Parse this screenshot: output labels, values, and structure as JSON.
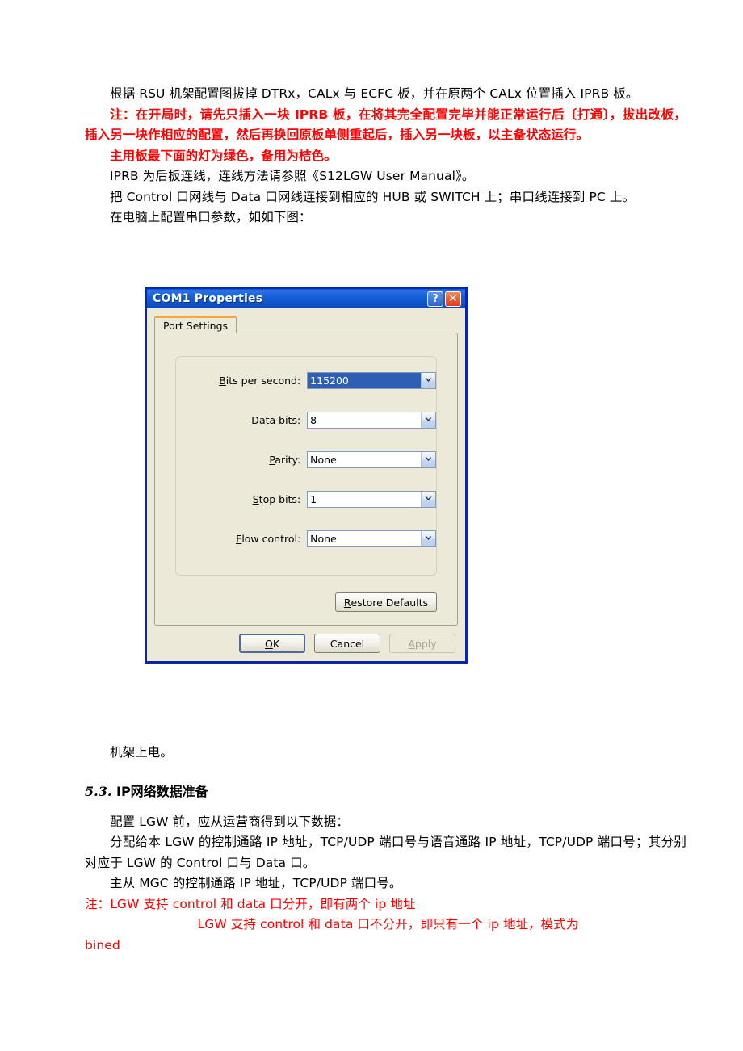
{
  "document": {
    "paragraphs": [
      {
        "id": "p1",
        "text": "根据 RSU 机架配置图拔掉 DTRx，CALx 与 ECFC 板，并在原两个 CALx 位置插入 IPRB 板。",
        "color": "#000000"
      },
      {
        "id": "p2",
        "text": "注：在开局时，请先只插入一块 IPRB 板，在将其完全配置完毕并能正常运行后〔打通〕，拔出改板，插入另一块作相应的配置，然后再换回原板单侧重起后，插入另一块板，以主备状态运行。",
        "color": "#ff0000"
      },
      {
        "id": "p3",
        "text": "主用板最下面的灯为绿色，备用为桔色。",
        "color": "#ff0000"
      },
      {
        "id": "p4",
        "text": "IPRB 为后板连线，连线方法请参照《S12LGW User Manual》。",
        "color": "#000000"
      },
      {
        "id": "p5",
        "text": "把 Control 口网线与 Data 口网线连接到相应的 HUB 或 SWITCH 上；串口线连接到 PC 上。",
        "color": "#000000"
      },
      {
        "id": "p6",
        "text": "在电脑上配置串口参数，如如下图：",
        "color": "#000000"
      }
    ],
    "after_dialog": {
      "rack_power_text": "机架上电。",
      "heading_number": "5.3.",
      "heading_title": "IP网络数据准备",
      "paragraphs": [
        {
          "id": "p7",
          "text": "配置 LGW 前，应从运营商得到以下数据：",
          "color": "#000000"
        },
        {
          "id": "p8",
          "text": "分配给本 LGW 的控制通路 IP 地址，TCP/UDP 端口号与语音通路 IP 地址，TCP/UDP 端口号；其分别对应于 LGW 的 Control 口与 Data 口。",
          "color": "#000000"
        },
        {
          "id": "p9",
          "text": "主从 MGC 的控制通路 IP 地址，TCP/UDP 端口号。",
          "color": "#000000"
        }
      ],
      "note_lines": [
        {
          "id": "n1",
          "text": "注：LGW 支持 control 和 data 口分开，即有两个 ip 地址",
          "indent": false
        },
        {
          "id": "n2",
          "text": "LGW 支持 control 和 data 口不分开，即只有一个 ip 地址，模式为",
          "indent": true
        },
        {
          "id": "n3",
          "text": "bined",
          "indent": false
        }
      ],
      "note_color": "#ff0000"
    }
  },
  "dialog": {
    "title": "COM1 Properties",
    "titlebar_buttons": [
      {
        "name": "help-button",
        "glyph": "?"
      },
      {
        "name": "close-button",
        "glyph": "✕"
      }
    ],
    "tabs": [
      {
        "label": "Port Settings",
        "active": true
      }
    ],
    "fields": [
      {
        "label_prefix": "",
        "label_accel": "B",
        "label_rest": "its per second:",
        "value": "115200",
        "selected": true,
        "name": "bits-per-second"
      },
      {
        "label_prefix": "",
        "label_accel": "D",
        "label_rest": "ata bits:",
        "value": "8",
        "selected": false,
        "name": "data-bits"
      },
      {
        "label_prefix": "",
        "label_accel": "P",
        "label_rest": "arity:",
        "value": "None",
        "selected": false,
        "name": "parity"
      },
      {
        "label_prefix": "",
        "label_accel": "S",
        "label_rest": "top bits:",
        "value": "1",
        "selected": false,
        "name": "stop-bits"
      },
      {
        "label_prefix": "",
        "label_accel": "F",
        "label_rest": "low control:",
        "value": "None",
        "selected": false,
        "name": "flow-control"
      }
    ],
    "restore_defaults": {
      "accel": "R",
      "rest": "estore Defaults"
    },
    "footer_buttons": [
      {
        "name": "ok-button",
        "accel": "O",
        "rest": "K",
        "state": "default"
      },
      {
        "name": "cancel-button",
        "accel": "",
        "rest": "Cancel",
        "state": "normal"
      },
      {
        "name": "apply-button",
        "accel": "A",
        "rest": "pply",
        "state": "disabled"
      }
    ],
    "colors": {
      "titlebar": "#1560d4",
      "border": "#0a26a8",
      "face": "#ece9d8",
      "tab_highlight": "#f5a93c",
      "selection": "#2f5fb4",
      "close": "#d6401c"
    }
  }
}
